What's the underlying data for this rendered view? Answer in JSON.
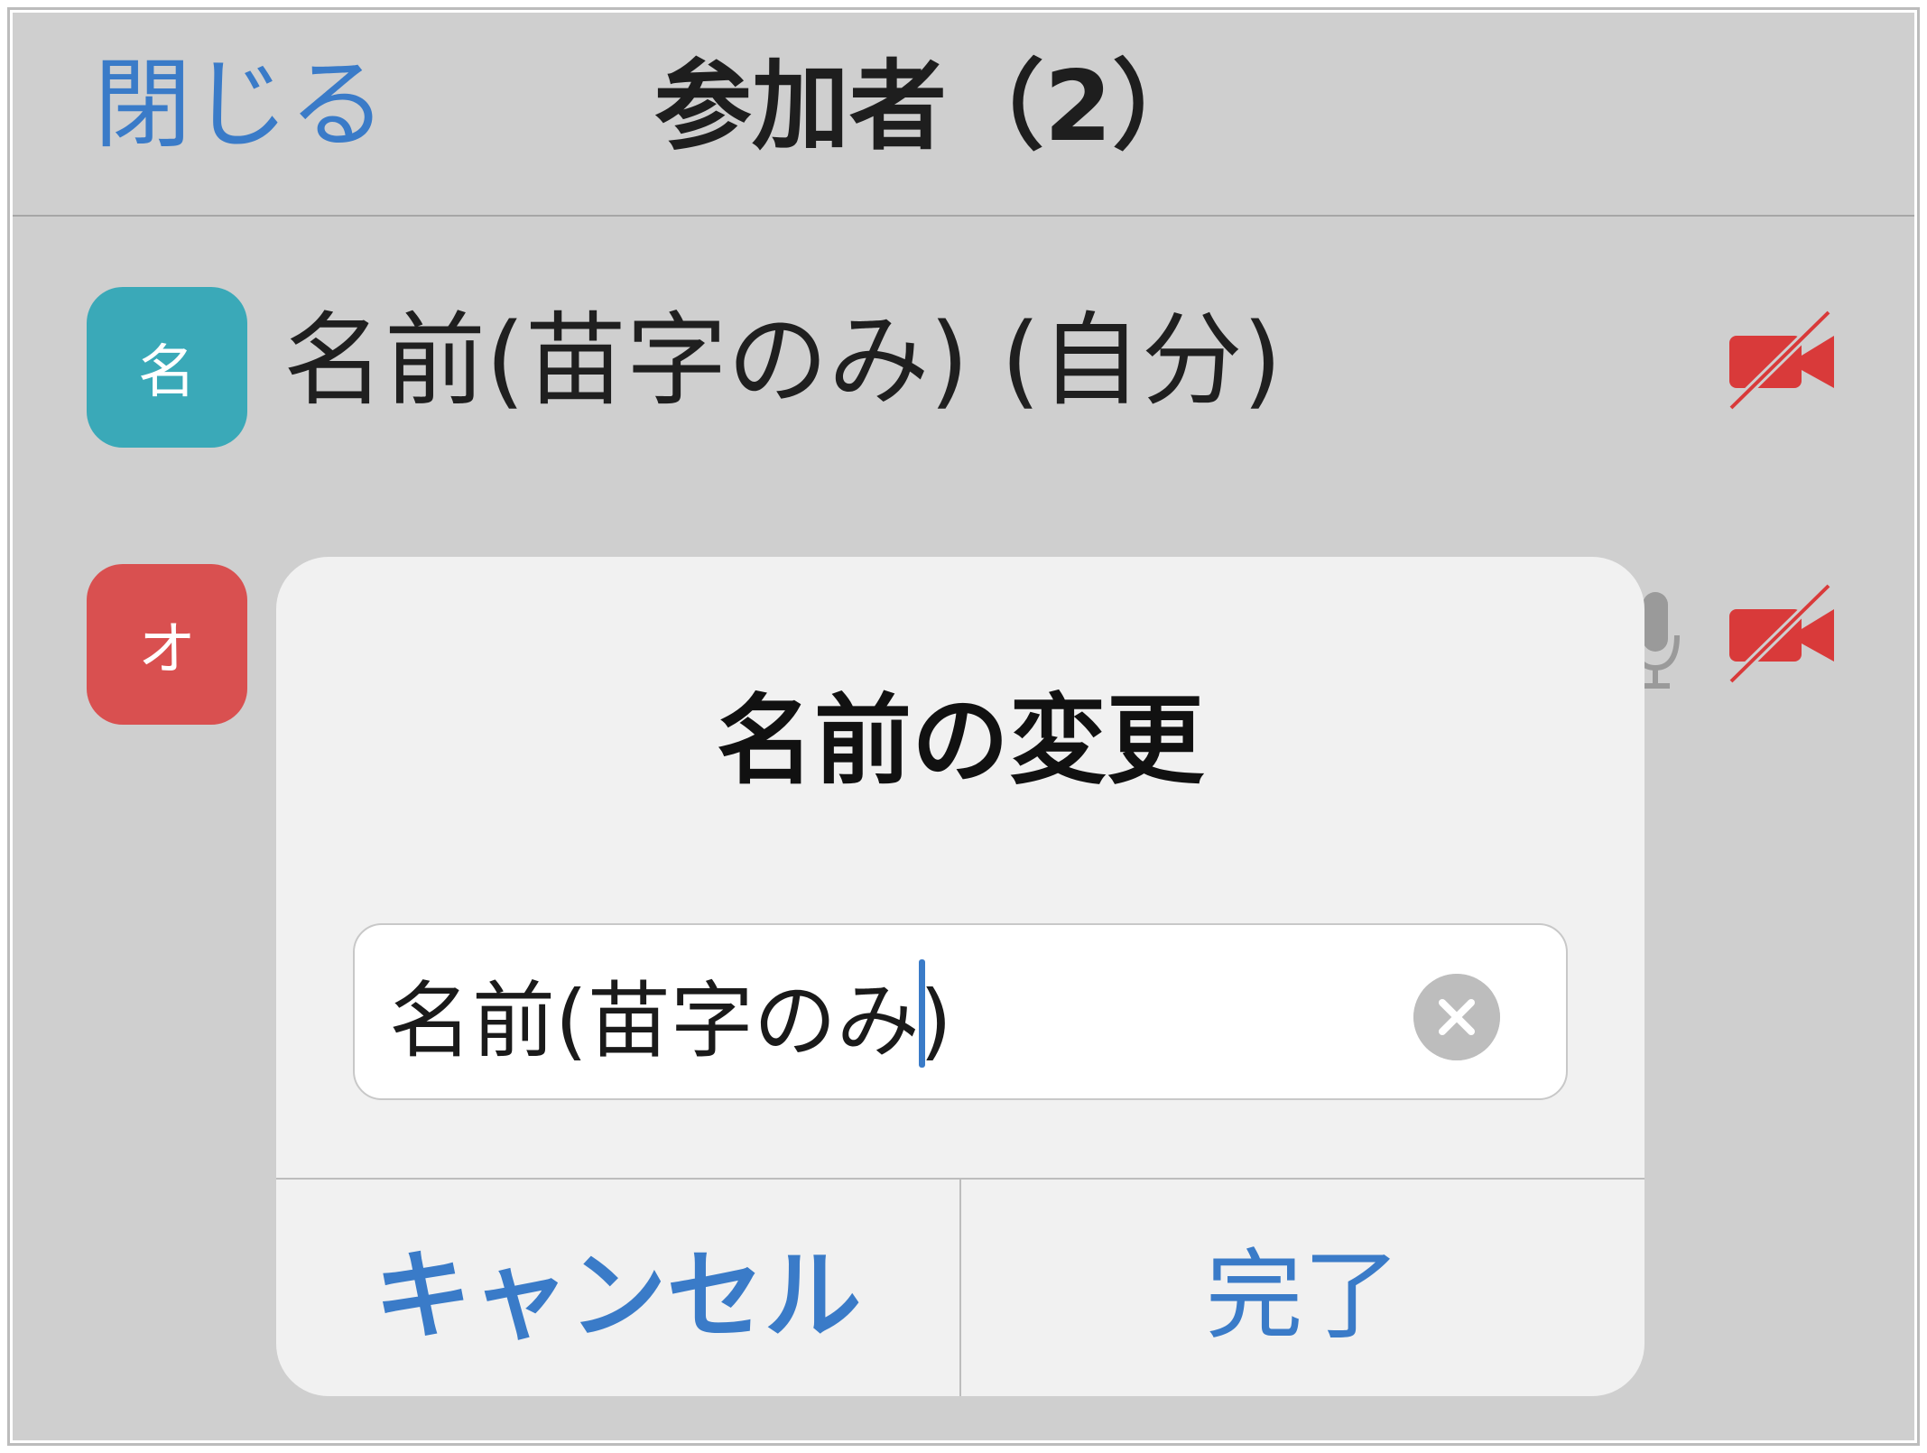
{
  "header": {
    "close_label": "閉じる",
    "title": "参加者（2）"
  },
  "participants": [
    {
      "initial": "名",
      "name": "名前(苗字のみ) (自分)",
      "avatar_color": "#3aa9b8",
      "mic_icon": "microphone-icon",
      "camera_icon": "video-off-icon"
    },
    {
      "initial": "オ",
      "name": "",
      "avatar_color": "#d95050",
      "mic_icon": "microphone-icon",
      "camera_icon": "video-off-icon"
    }
  ],
  "dialog": {
    "title": "名前の変更",
    "input_value": "名前(苗字のみ)",
    "clear_icon": "clear-icon",
    "cancel_label": "キャンセル",
    "done_label": "完了"
  },
  "colors": {
    "accent": "#3a7bc8",
    "video_off": "#d93a3a",
    "background": "#cfcfcf",
    "dialog_background": "#f1f1f1"
  }
}
